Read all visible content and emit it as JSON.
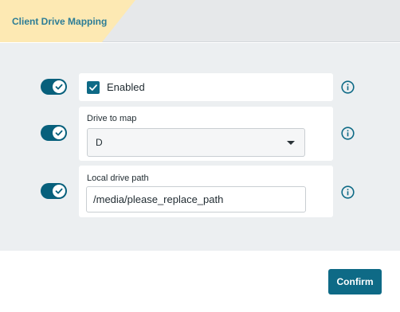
{
  "header": {
    "title": "Client Drive Mapping"
  },
  "rows": {
    "enabled": {
      "toggle_on": true,
      "checked": true,
      "label": "Enabled"
    },
    "drive": {
      "toggle_on": true,
      "label": "Drive to map",
      "selected_value": "D"
    },
    "path": {
      "toggle_on": true,
      "label": "Local drive path",
      "value": "/media/please_replace_path"
    }
  },
  "footer": {
    "confirm_label": "Confirm"
  },
  "icons": {
    "toggle": "check-icon",
    "info": "info-icon",
    "select": "caret-down-icon"
  },
  "colors": {
    "accent": "#0e6a86",
    "toggle": "#07607c",
    "tab": "#fde9b3",
    "title": "#2d7d96",
    "panel": "#eceff1"
  }
}
